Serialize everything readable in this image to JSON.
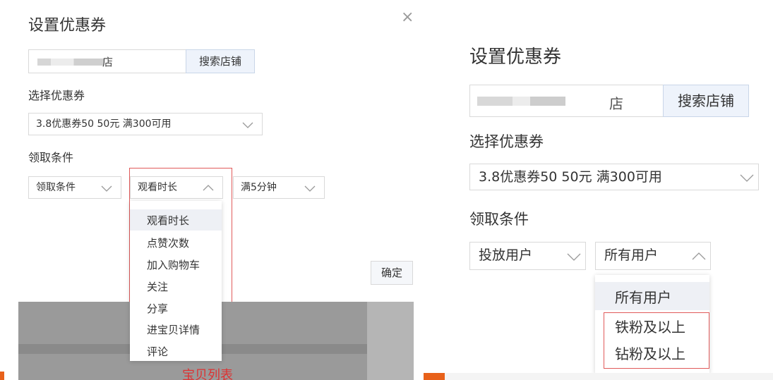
{
  "left": {
    "title": "设置优惠券",
    "close_icon": "×",
    "shop_input_suffix": "店",
    "search_button": "搜索店铺",
    "select_coupon_label": "选择优惠券",
    "coupon_value": "3.8优惠券50 50元 满300可用",
    "condition_label": "领取条件",
    "condition_select": "领取条件",
    "metric_select": "观看时长",
    "threshold_select": "满5分钟",
    "dropdown_items": [
      "观看时长",
      "点赞次数",
      "加入购物车",
      "关注",
      "分享",
      "进宝贝详情",
      "评论"
    ],
    "confirm_button": "确定",
    "underlay_text": "宝贝列表"
  },
  "right": {
    "title": "设置优惠券",
    "shop_input_suffix": "店",
    "search_button": "搜索店铺",
    "select_coupon_label": "选择优惠券",
    "coupon_value": "3.8优惠券50 50元 满300可用",
    "condition_label": "领取条件",
    "audience_select": "投放用户",
    "users_select": "所有用户",
    "dropdown_items": [
      "所有用户",
      "铁粉及以上",
      "钻粉及以上"
    ]
  }
}
